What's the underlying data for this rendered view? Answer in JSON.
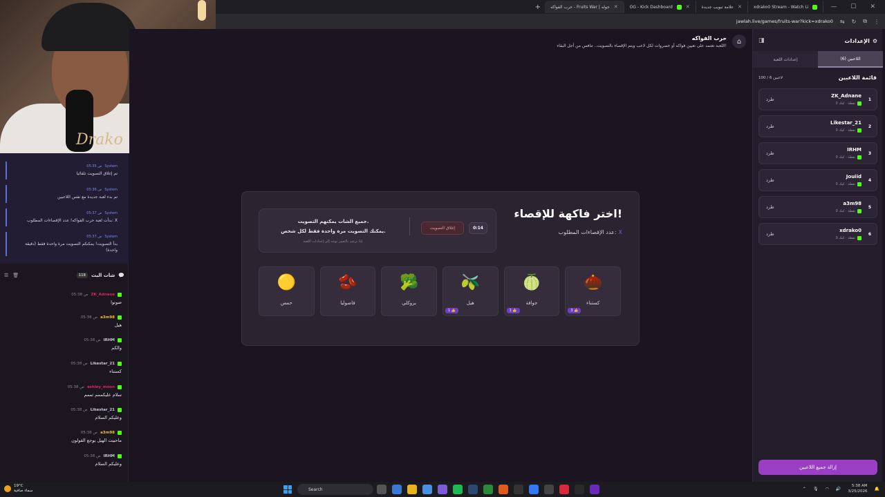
{
  "browser": {
    "tabs": [
      {
        "label": "xdrako0 Stream - Watch Li"
      },
      {
        "label": "علامة تبويب جديدة"
      },
      {
        "label": ""
      },
      {
        "label": "OG - Kick Dashboard"
      },
      {
        "label": "حرب الفواكه - Fruits War | جوله",
        "active": true
      }
    ],
    "url": "jawlah.live/games/fruits-war?kick=xdrako0"
  },
  "webcam": {
    "signature": "Drako"
  },
  "system_messages": [
    {
      "time": "05:35 ص",
      "user": "System",
      "text": "تم إغلاق التصويت تلقائيا"
    },
    {
      "time": "05:36 ص",
      "user": "System",
      "text": "تم بدء لعبة جديدة مع نفس اللاعبين"
    },
    {
      "time": "05:37 ص",
      "user": "System",
      "text": "بدأت لعبة حرب الفواكه! عدد الإقصاءات المطلوب: X"
    },
    {
      "time": "05:37 ص",
      "user": "System",
      "text": "بدأ التصويت! يمكنكم التصويت مرة واحدة فقط (دقيقة واحدة)"
    }
  ],
  "chat": {
    "title": "شات البث",
    "count": "118",
    "messages": [
      {
        "time": "05:38 ص",
        "user": "ZK_Adnane",
        "color": "#e0245e",
        "text": "صوتوا"
      },
      {
        "time": "05:38 ص",
        "user": "a3m98",
        "color": "#f0c020",
        "text": "هيل"
      },
      {
        "time": "05:38 ص",
        "user": "IRHM",
        "color": "#c8c8d8",
        "text": "والكم"
      },
      {
        "time": "05:38 ص",
        "user": "Likestar_21",
        "color": "#c8c8d8",
        "text": "كستناء"
      },
      {
        "time": "05:38 ص",
        "user": "ashley_moon",
        "color": "#e0245e",
        "text": "سلام عليكممم ثممم"
      },
      {
        "time": "05:38 ص",
        "user": "Likestar_21",
        "color": "#c8c8d8",
        "text": "وعليكم السلام"
      },
      {
        "time": "05:38 ص",
        "user": "a3m98",
        "color": "#f0c020",
        "text": "ماحبيت الهيل يوجع القولون"
      },
      {
        "time": "05:38 ص",
        "user": "IRHM",
        "color": "#c8c8d8",
        "text": "وعليكم السلام"
      }
    ]
  },
  "game": {
    "title": "حرب الفواكه",
    "subtitle": "اللعبة تعتمد على تعيين فواكه أو خضروات لكل لاعب ويتم الإقصاء بالتصويت.. تنافس من أجل البقاء!",
    "pick_title": "اختر فاكهة للإقصاء!",
    "elim_label": "عدد الإقصاءات المطلوب:",
    "elim_value": "X",
    "timer": "0:14",
    "close_vote": "إغلاق التصويت",
    "vote_line1": "جميع الشات يمكنهم التصويت.",
    "vote_line2": "يمكنك التصويت مرة واحدة فقط لكل شخص.",
    "vote_line3": "إذا ترغب بالتغيير توجه إلى إعدادات اللعبة.",
    "fruits": [
      {
        "name": "كستناء",
        "icon": "🌰",
        "votes": "3"
      },
      {
        "name": "جوافة",
        "icon": "🍈",
        "votes": "1"
      },
      {
        "name": "هيل",
        "icon": "🫒",
        "votes": "1"
      },
      {
        "name": "بروكلي",
        "icon": "🥦",
        "votes": ""
      },
      {
        "name": "فاصوليا",
        "icon": "🫘",
        "votes": ""
      },
      {
        "name": "حمص",
        "icon": "🟡",
        "votes": ""
      }
    ]
  },
  "panel": {
    "title": "الإعدادات",
    "tab_players": "اللاعبين (6)",
    "tab_settings": "إعدادات اللعبة",
    "list_title": "قائمة اللاعبين",
    "list_count": "100 / 6 لاعبين",
    "kick_label": "طرد",
    "players": [
      {
        "num": "1",
        "name": "ZK_Adnane",
        "meta": "0 نقطة · كيك"
      },
      {
        "num": "2",
        "name": "Likestar_21",
        "meta": "0 نقطة · كيك"
      },
      {
        "num": "3",
        "name": "IRHM",
        "meta": "0 نقطة · كيك"
      },
      {
        "num": "4",
        "name": "Jouiid",
        "meta": "0 نقطة · كيك"
      },
      {
        "num": "5",
        "name": "a3m98",
        "meta": "0 نقطة · كيك"
      },
      {
        "num": "6",
        "name": "xdrako0",
        "meta": "0 نقطة · كيك"
      }
    ],
    "remove_all": "إزالة جميع اللاعبين"
  },
  "taskbar": {
    "temp": "19°C",
    "weather": "سماء صافية",
    "search": "Search",
    "time": "5:38 AM",
    "date": "3/25/2026"
  }
}
